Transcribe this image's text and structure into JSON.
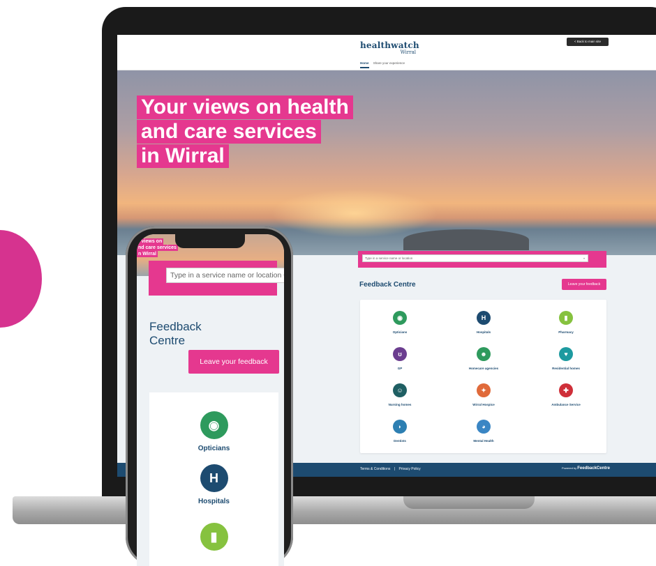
{
  "brand": {
    "name": "healthwatch",
    "area": "Wirral",
    "colors": {
      "pink": "#e5388f",
      "navy": "#1d4b70"
    }
  },
  "header": {
    "back_button": "< Back to main site",
    "nav": [
      "Home",
      "Share your experience"
    ]
  },
  "hero": {
    "lines": [
      "Your views on health",
      "and care services",
      "in Wirral"
    ]
  },
  "search": {
    "placeholder": "Type in a service name or location"
  },
  "feedback_centre": {
    "title": "Feedback Centre",
    "leave_button": "Leave your feedback"
  },
  "services": [
    {
      "label": "Opticians",
      "icon": "eye-icon",
      "color": "#2e9a5d",
      "glyph": "◉"
    },
    {
      "label": "Hospitals",
      "icon": "hospital-icon",
      "color": "#1d4b70",
      "glyph": "H"
    },
    {
      "label": "Pharmacy",
      "icon": "pill-icon",
      "color": "#86c23f",
      "glyph": "▮"
    },
    {
      "label": "GP",
      "icon": "stethoscope-icon",
      "color": "#6b3d8f",
      "glyph": "ʊ"
    },
    {
      "label": "Homecare agencies",
      "icon": "people-icon",
      "color": "#2e9a5d",
      "glyph": "☻"
    },
    {
      "label": "Residential homes",
      "icon": "heart-hands-icon",
      "color": "#1d9aa0",
      "glyph": "♥"
    },
    {
      "label": "Nursing homes",
      "icon": "group-icon",
      "color": "#1f5f63",
      "glyph": "☺"
    },
    {
      "label": "Wirral Hospice",
      "icon": "dove-icon",
      "color": "#e06a3a",
      "glyph": "✦"
    },
    {
      "label": "Ambulance Service",
      "icon": "ambulance-icon",
      "color": "#cf2f39",
      "glyph": "✚"
    },
    {
      "label": "Dentists",
      "icon": "tooth-icon",
      "color": "#2d7fb2",
      "glyph": "◗"
    },
    {
      "label": "Mental Health",
      "icon": "brain-icon",
      "color": "#3a86c4",
      "glyph": "◕"
    }
  ],
  "footer": {
    "links": [
      "Terms & Conditions",
      "|",
      "Privacy Policy"
    ],
    "powered_prefix": "Powered by",
    "powered_name": "FeedbackCentre"
  },
  "phone": {
    "hero_lines": [
      "r views on",
      "nd care services",
      "n Wirral"
    ],
    "search_placeholder": "Type in a service name or location",
    "feedback_title_line1": "Feedback",
    "feedback_title_line2": "Centre",
    "leave_button": "Leave your feedback",
    "services": [
      {
        "label": "Opticians",
        "icon": "eye-icon",
        "color": "#2e9a5d",
        "glyph": "◉"
      },
      {
        "label": "Hospitals",
        "icon": "hospital-icon",
        "color": "#1d4b70",
        "glyph": "H"
      },
      {
        "label": "",
        "icon": "pill-icon",
        "color": "#86c23f",
        "glyph": "▮"
      }
    ]
  }
}
